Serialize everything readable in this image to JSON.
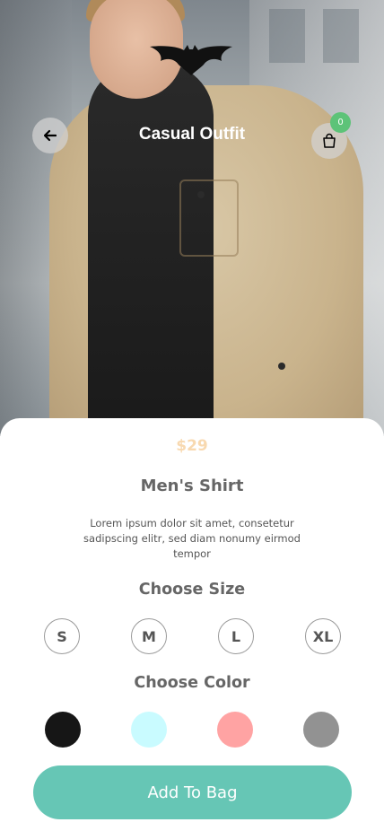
{
  "header": {
    "title": "Casual Outfit",
    "back_icon": "arrow-left-icon",
    "logo_icon": "bat-logo-icon",
    "bag_icon": "shopping-bag-icon",
    "bag_count": "0"
  },
  "product": {
    "price": "$29",
    "name": "Men's Shirt",
    "description": "Lorem ipsum dolor sit amet, consetetur sadipscing elitr, sed diam nonumy eirmod tempor"
  },
  "size_section": {
    "title": "Choose Size",
    "options": [
      "S",
      "M",
      "L",
      "XL"
    ]
  },
  "color_section": {
    "title": "Choose Color",
    "options": [
      "#161616",
      "#c9fbff",
      "#ffa3a3",
      "#929292"
    ]
  },
  "actions": {
    "add_to_bag": "Add To Bag"
  },
  "colors": {
    "accent": "#66c6b5",
    "price": "#f8d9b0",
    "badge": "#5dc378"
  }
}
